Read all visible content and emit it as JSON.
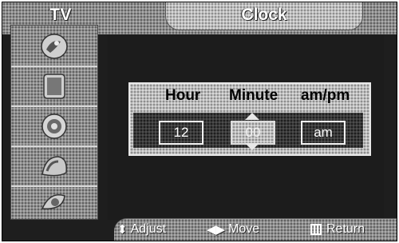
{
  "header": {
    "menu_title": "TV",
    "screen_title": "Clock"
  },
  "sidebar": {
    "items": [
      {
        "icon": "picture-icon"
      },
      {
        "icon": "sound-icon"
      },
      {
        "icon": "channel-icon"
      },
      {
        "icon": "setup-icon"
      },
      {
        "icon": "input-icon"
      }
    ]
  },
  "clock": {
    "columns": {
      "hour": "Hour",
      "minute": "Minute",
      "ampm": "am/pm"
    },
    "values": {
      "hour": "12",
      "minute": "00",
      "ampm": "am"
    },
    "selected_field": "minute"
  },
  "footer": {
    "adjust": "Adjust",
    "move": "Move",
    "return": "Return"
  },
  "colors": {
    "background": "#1e1e1e",
    "panel": "#bdbdbd",
    "text": "#ffffff"
  }
}
